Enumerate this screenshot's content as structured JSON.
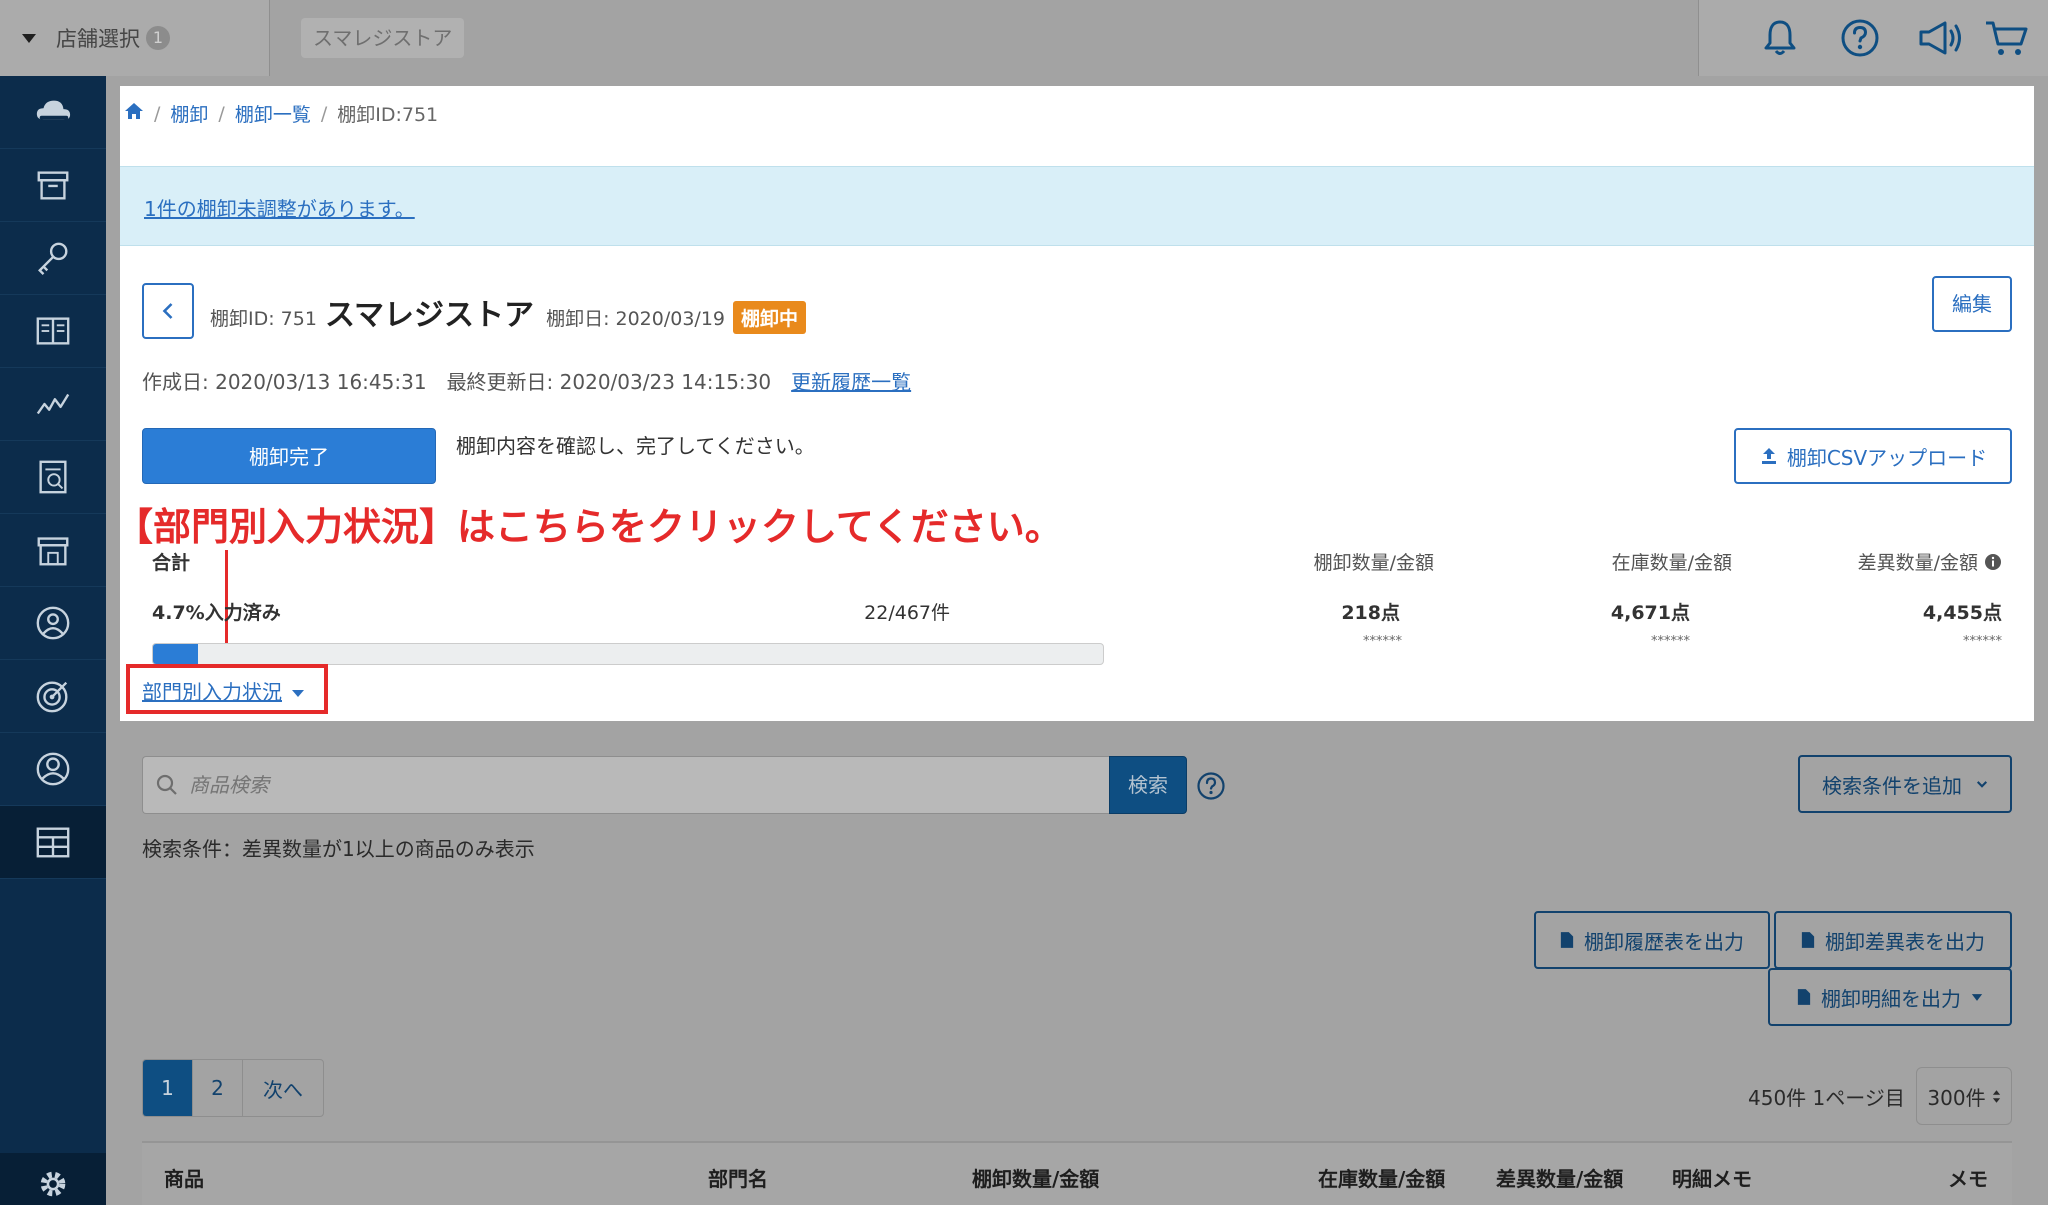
{
  "topbar": {
    "store_select_label": "店舗選択",
    "store_select_badge": "1",
    "store_chip": "スマレジストア",
    "icons": [
      "bell-icon",
      "help-circle-icon",
      "megaphone-icon",
      "cart-icon"
    ]
  },
  "sidebar": {
    "items": [
      "cloud-icon",
      "archive-icon",
      "key-icon",
      "book-icon",
      "chart-icon",
      "report-icon",
      "store-icon",
      "user-circle-icon",
      "target-icon",
      "account-icon",
      "inventory-grid-icon"
    ],
    "active_index": 10,
    "settings_icon": "gear-icon"
  },
  "breadcrumb": {
    "home_icon": "home-icon",
    "items": [
      "棚卸",
      "棚卸一覧"
    ],
    "current": "棚卸ID:751"
  },
  "alert": {
    "text": "1件の棚卸未調整があります。"
  },
  "header": {
    "id_label": "棚卸ID: 751",
    "store_name": "スマレジストア",
    "date_label": "棚卸日: 2020/03/19",
    "status": "棚卸中",
    "edit_label": "編集"
  },
  "dates": {
    "created": "作成日: 2020/03/13 16:45:31",
    "updated": "最終更新日: 2020/03/23 14:15:30",
    "history_link": "更新履歴一覧"
  },
  "actions": {
    "complete_label": "棚卸完了",
    "complete_message": "棚卸内容を確認し、完了してください。",
    "csv_upload_label": "棚卸CSVアップロード"
  },
  "annotation": "【部門別入力状況】はこちらをクリックしてください。",
  "summary": {
    "total_label": "合計",
    "progress_label": "4.7%入力済み",
    "progress_fraction": 0.047,
    "progress_count": "22/467件",
    "columns": [
      {
        "header": "棚卸数量/金額",
        "value": "218点",
        "mask": "******"
      },
      {
        "header": "在庫数量/金額",
        "value": "4,671点",
        "mask": "******"
      },
      {
        "header": "差異数量/金額",
        "value": "4,455点",
        "mask": "******"
      }
    ],
    "dept_link": "部門別入力状況"
  },
  "search": {
    "placeholder": "商品検索",
    "button_label": "検索",
    "add_condition_label": "検索条件を追加",
    "condition_text": "検索条件：差異数量が1以上の商品のみ表示"
  },
  "exports": {
    "history_label": "棚卸履歴表を出力",
    "diff_label": "棚卸差異表を出力",
    "detail_label": "棚卸明細を出力"
  },
  "pagination": {
    "pages": [
      "1",
      "2"
    ],
    "next_label": "次へ",
    "info": "450件 1ページ目",
    "per_page": "300件"
  },
  "table": {
    "headers": [
      "商品",
      "部門名",
      "棚卸数量/金額",
      "在庫数量/金額",
      "差異数量/金額",
      "明細メモ",
      "メモ"
    ]
  },
  "colors": {
    "sidebar_bg": "#0c2c4b",
    "link_blue": "#2b6fc0",
    "primary_blue": "#2b7dd6",
    "status_orange": "#e98a1c",
    "annotation_red": "#e52a2a",
    "alert_bg": "#d9eff8"
  }
}
